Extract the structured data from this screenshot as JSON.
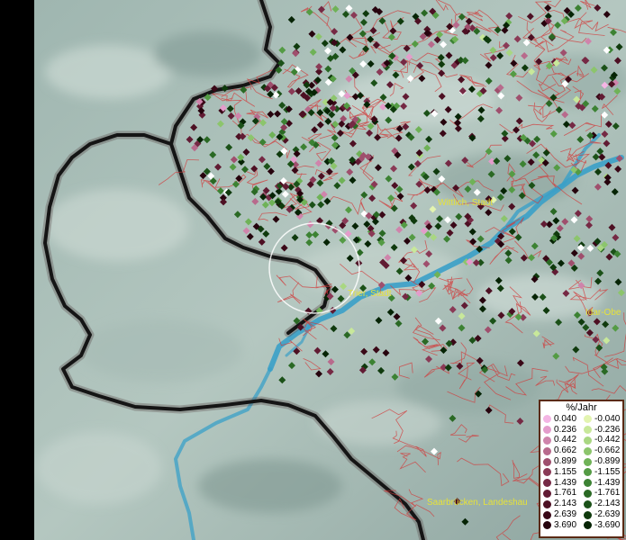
{
  "legend": {
    "title": "%/Jahr",
    "positive": [
      {
        "label": "0.040",
        "color": "#f4b5e4"
      },
      {
        "label": "0.236",
        "color": "#e49ccb"
      },
      {
        "label": "0.442",
        "color": "#cf84ab"
      },
      {
        "label": "0.662",
        "color": "#b86a8c"
      },
      {
        "label": "0.899",
        "color": "#9f4f6d"
      },
      {
        "label": "1.155",
        "color": "#8a3a56"
      },
      {
        "label": "1.439",
        "color": "#752944"
      },
      {
        "label": "1.761",
        "color": "#611b33"
      },
      {
        "label": "2.143",
        "color": "#4d1023"
      },
      {
        "label": "2.639",
        "color": "#3a0817"
      },
      {
        "label": "3.690",
        "color": "#26030d"
      }
    ],
    "negative": [
      {
        "label": "-0.040",
        "color": "#e3f4b0"
      },
      {
        "label": "-0.236",
        "color": "#c8e89a"
      },
      {
        "label": "-0.442",
        "color": "#a9d782"
      },
      {
        "label": "-0.662",
        "color": "#8cc56c"
      },
      {
        "label": "-0.899",
        "color": "#6fb257"
      },
      {
        "label": "-1.155",
        "color": "#549b44"
      },
      {
        "label": "-1.439",
        "color": "#3c8233"
      },
      {
        "label": "-1.761",
        "color": "#2a6924"
      },
      {
        "label": "-2.143",
        "color": "#1b5118"
      },
      {
        "label": "-2.639",
        "color": "#0f3a0d"
      },
      {
        "label": "-3.690",
        "color": "#062405"
      }
    ]
  },
  "cities": [
    {
      "name": "Wittlich, Stadt"
    },
    {
      "name": "Trier, Stadt"
    },
    {
      "name": "Idar-Obe"
    },
    {
      "name": "Saarbrücken, Landeshau"
    }
  ]
}
